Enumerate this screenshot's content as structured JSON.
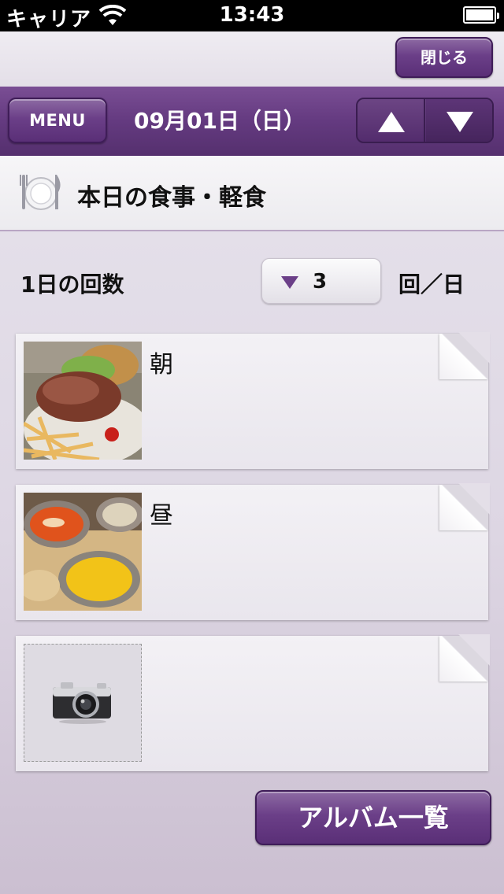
{
  "status_bar": {
    "carrier": "キャリア",
    "time": "13:43",
    "battery_icon": "battery-icon",
    "wifi_icon": "wifi-icon"
  },
  "header": {
    "close_label": "閉じる"
  },
  "nav": {
    "menu_label": "MENU",
    "date": "09月01日（日）",
    "up_icon": "arrow-up-icon",
    "down_icon": "arrow-down-icon"
  },
  "section": {
    "title": "本日の食事・軽食",
    "icon": "plate-fork-knife-icon"
  },
  "count": {
    "label": "1日の回数",
    "value": "3",
    "unit": "回／日"
  },
  "meals": [
    {
      "label": "朝",
      "photo": "burger-fries-photo"
    },
    {
      "label": "昼",
      "photo": "curry-naan-photo"
    },
    {
      "label": "",
      "photo": "camera-placeholder-icon"
    }
  ],
  "footer": {
    "album_label": "アルバム一覧"
  },
  "colors": {
    "accent": "#643a80",
    "background": "#e4dfe8"
  }
}
